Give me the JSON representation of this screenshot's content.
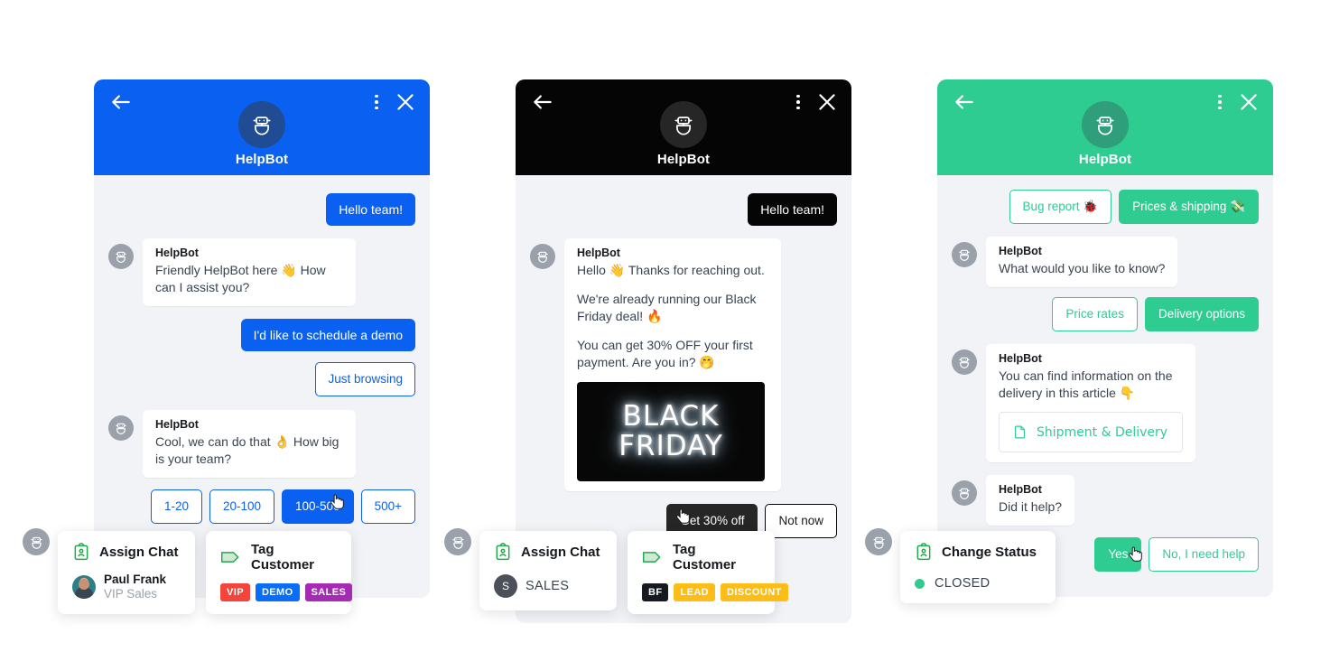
{
  "panels": [
    {
      "id": "blue",
      "accent": "#0a60f0",
      "accent_dark": "#1f4c93",
      "header": {
        "title": "HelpBot",
        "back_icon": "arrow-left-icon",
        "menu_icon": "overflow-menu-icon",
        "close_icon": "close-icon",
        "avatar_icon": "robot-avatar-icon"
      },
      "messages": [
        {
          "type": "user",
          "text": "Hello team!"
        },
        {
          "type": "bot",
          "name": "HelpBot",
          "lines": [
            "Friendly HelpBot here 👋 How can I assist you?"
          ]
        },
        {
          "type": "user",
          "text": "I'd like to schedule a demo"
        },
        {
          "type": "chip-single",
          "text": "Just browsing"
        },
        {
          "type": "bot",
          "name": "HelpBot",
          "lines": [
            "Cool, we can do that 👌 How big is your team?"
          ]
        }
      ],
      "quick_replies": [
        {
          "label": "1-20",
          "selected": false
        },
        {
          "label": "20-100",
          "selected": false
        },
        {
          "label": "100-500",
          "selected": true
        },
        {
          "label": "500+",
          "selected": false
        }
      ],
      "cards": [
        {
          "kind": "assign",
          "icon": "id-badge-icon",
          "title": "Assign Chat",
          "person": {
            "name": "Paul Frank",
            "role": "VIP Sales",
            "avatar": "agent-photo-avatar"
          }
        },
        {
          "kind": "tag",
          "icon": "tag-icon",
          "title": "Tag Customer",
          "tags": [
            {
              "label": "VIP",
              "color": "#f4453c"
            },
            {
              "label": "DEMO",
              "color": "#0a6df7"
            },
            {
              "label": "SALES",
              "color": "#a52bb5"
            }
          ]
        }
      ]
    },
    {
      "id": "black",
      "accent": "#050505",
      "accent_dark": "#262626",
      "header": {
        "title": "HelpBot",
        "back_icon": "arrow-left-icon",
        "menu_icon": "overflow-menu-icon",
        "close_icon": "close-icon",
        "avatar_icon": "robot-avatar-icon"
      },
      "messages": [
        {
          "type": "user",
          "text": "Hello team!"
        },
        {
          "type": "bot",
          "name": "HelpBot",
          "lines": [
            "Hello 👋 Thanks for reaching out.",
            "We're already running our Black Friday deal! 🔥",
            "You can get 30% OFF your first payment. Are you in? 🤭"
          ],
          "image": {
            "line1": "BLACK",
            "line2": "FRIDAY",
            "alt": "black-friday-neon-banner"
          }
        }
      ],
      "quick_replies": [
        {
          "label": "Get 30% off",
          "selected": true
        },
        {
          "label": "Not now",
          "selected": false
        }
      ],
      "cards": [
        {
          "kind": "assign",
          "icon": "id-badge-icon",
          "title": "Assign Chat",
          "person": {
            "name": "SALES",
            "initial": "S",
            "avatar": "initial-avatar"
          }
        },
        {
          "kind": "tag",
          "icon": "tag-icon",
          "title": "Tag Customer",
          "tags": [
            {
              "label": "BF",
              "color": "#16191d"
            },
            {
              "label": "LEAD",
              "color": "#fbbd16"
            },
            {
              "label": "DISCOUNT",
              "color": "#fbbd16"
            }
          ]
        }
      ]
    },
    {
      "id": "green",
      "accent": "#2fcc92",
      "accent_dark": "#2e9e7b",
      "header": {
        "title": "HelpBot",
        "back_icon": "arrow-left-icon",
        "menu_icon": "overflow-menu-icon",
        "close_icon": "close-icon",
        "avatar_icon": "robot-avatar-icon"
      },
      "top_chips": [
        {
          "label": "Bug report 🐞",
          "selected": false
        },
        {
          "label": "Prices & shipping 💸",
          "selected": true
        }
      ],
      "messages": [
        {
          "type": "bot",
          "name": "HelpBot",
          "lines": [
            "What would you like to know?"
          ]
        },
        {
          "type": "chips",
          "items": [
            {
              "label": "Price rates",
              "selected": false
            },
            {
              "label": "Delivery options",
              "selected": true
            }
          ]
        },
        {
          "type": "bot",
          "name": "HelpBot",
          "lines": [
            "You can find information on the delivery in this article 👇"
          ],
          "article": {
            "icon": "document-icon",
            "label": "Shipment & Delivery"
          }
        },
        {
          "type": "bot",
          "name": "HelpBot",
          "lines": [
            "Did it help?"
          ]
        }
      ],
      "quick_replies": [
        {
          "label": "Yes",
          "selected": true
        },
        {
          "label": "No, I need help",
          "selected": false
        }
      ],
      "cards": [
        {
          "kind": "status",
          "icon": "id-badge-icon",
          "title": "Change Status",
          "status": {
            "label": "CLOSED",
            "color": "#2fcc92"
          }
        }
      ]
    }
  ]
}
